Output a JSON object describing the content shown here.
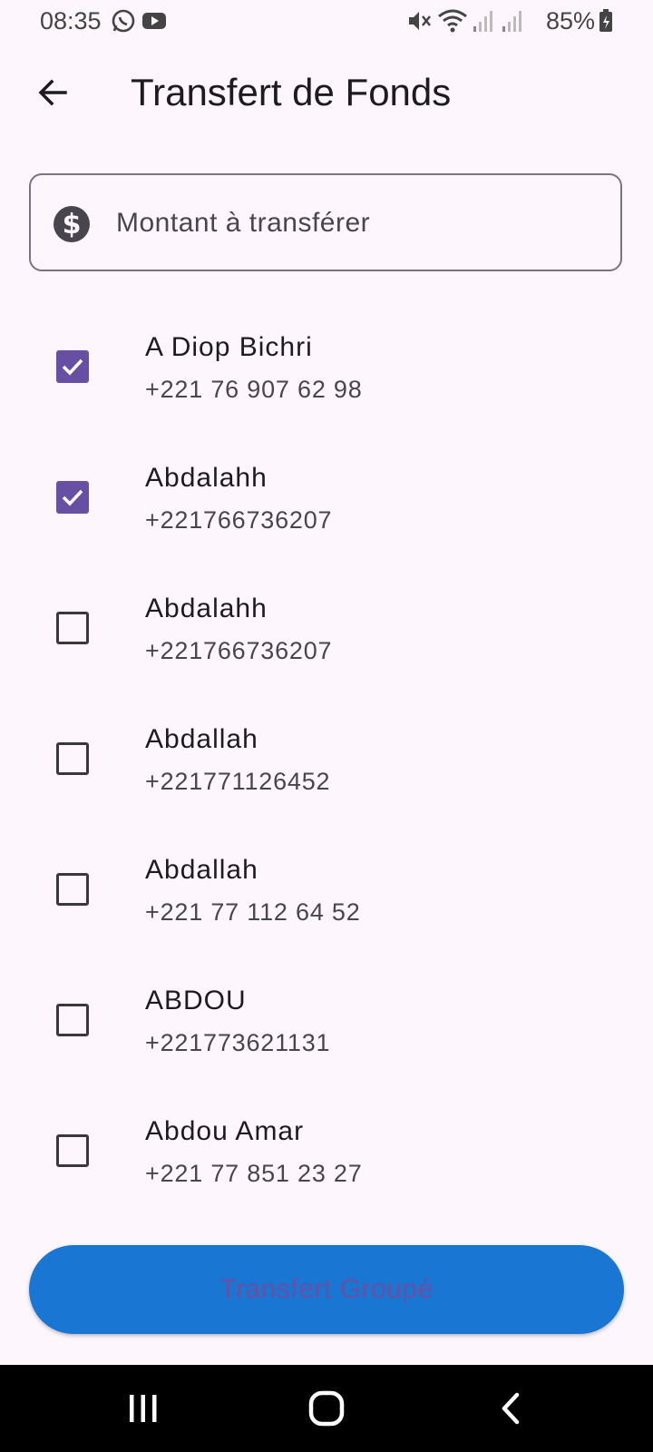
{
  "status_bar": {
    "time": "08:35",
    "battery": "85%",
    "icons": [
      "whatsapp-icon",
      "youtube-icon",
      "mute-icon",
      "wifi-icon",
      "signal-icon",
      "signal-icon",
      "battery-icon"
    ]
  },
  "appbar": {
    "title": "Transfert de Fonds",
    "back_icon": "arrow-back-icon"
  },
  "amount_field": {
    "placeholder": "Montant à transférer",
    "icon": "dollar-icon"
  },
  "contacts": [
    {
      "name": "A Diop Bichri",
      "phone": "+221 76 907 62 98",
      "checked": true
    },
    {
      "name": "Abdalahh",
      "phone": "+221766736207",
      "checked": true
    },
    {
      "name": "Abdalahh",
      "phone": "+221766736207",
      "checked": false
    },
    {
      "name": "Abdallah",
      "phone": "+221771126452",
      "checked": false
    },
    {
      "name": "Abdallah",
      "phone": "+221 77 112 64 52",
      "checked": false
    },
    {
      "name": "ABDOU",
      "phone": "+221773621131",
      "checked": false
    },
    {
      "name": "Abdou Amar",
      "phone": "+221 77 851 23 27",
      "checked": false
    }
  ],
  "group_button": {
    "label": "Transfert Groupé"
  },
  "colors": {
    "background": "#fdf7fd",
    "checkbox_checked": "#6750a4",
    "button_bg": "#1976d2",
    "button_text": "#6a4fa3"
  },
  "nav_bar": {
    "icons": [
      "recent-apps-icon",
      "home-icon",
      "back-icon"
    ]
  }
}
